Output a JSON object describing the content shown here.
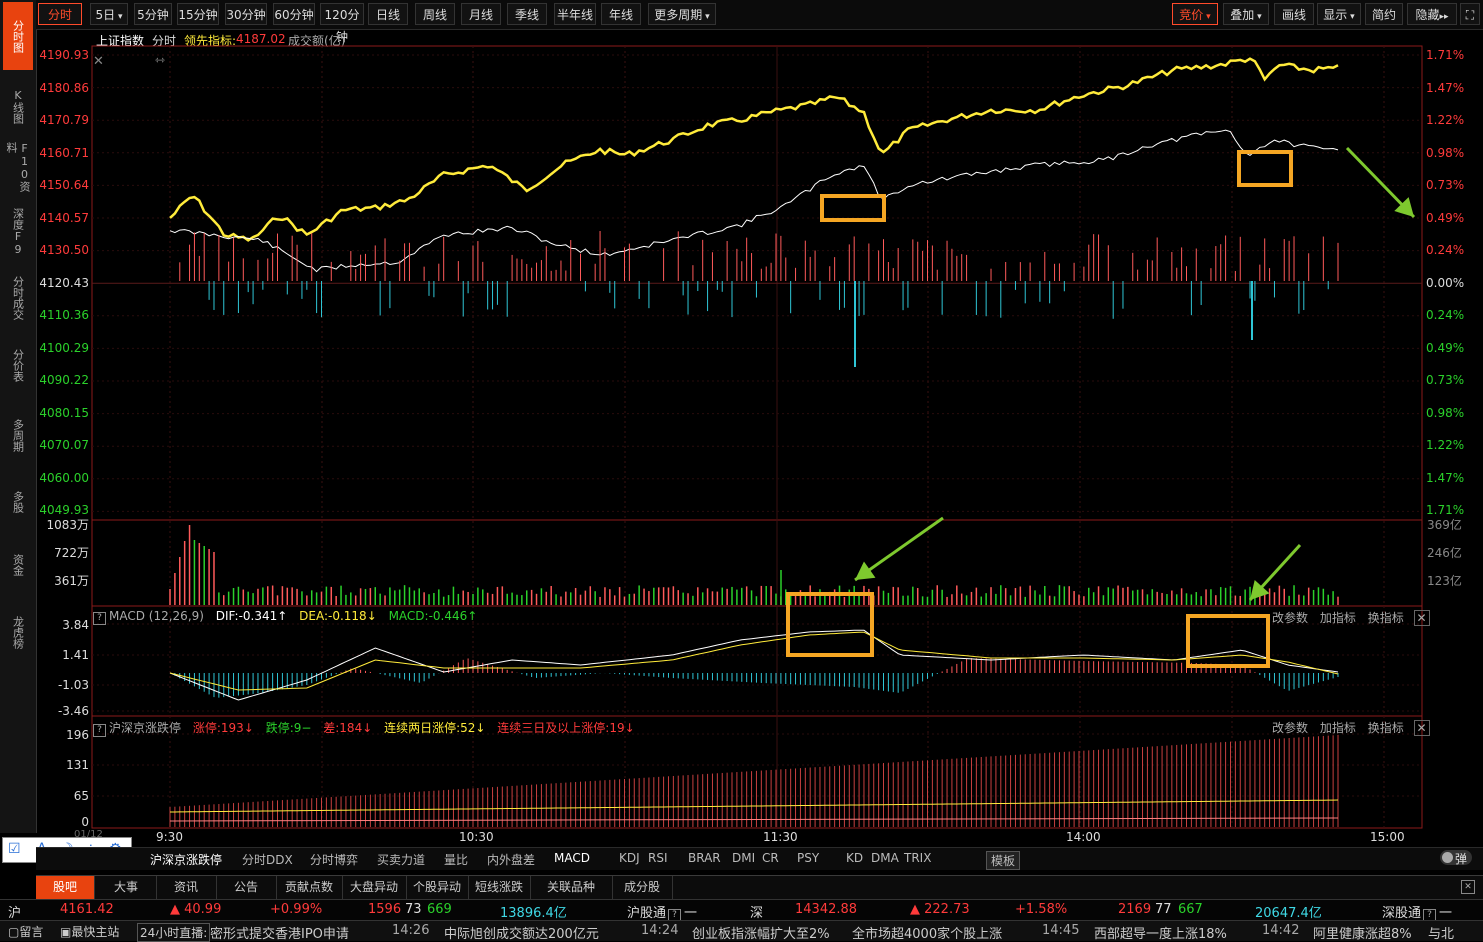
{
  "sidebar": {
    "items": [
      "分时图",
      "K线图",
      "F10资料",
      "深度F9",
      "分时成交",
      "分价表",
      "多周期",
      "多股",
      "资金",
      "龙虎榜"
    ]
  },
  "toolbar": {
    "left": [
      "分时",
      "5日",
      "5分钟",
      "15分钟",
      "30分钟",
      "60分钟",
      "120分钟",
      "日线",
      "周线",
      "月线",
      "季线",
      "半年线",
      "年线",
      "更多周期"
    ],
    "right": [
      "竞价",
      "叠加",
      "画线",
      "显示",
      "简约",
      "隐藏"
    ]
  },
  "header": {
    "name": "上证指数",
    "mode": "分时",
    "lead_label": "领先指标:",
    "lead_value": "4187.02",
    "volume_label": "成交额(亿)"
  },
  "price_axis": {
    "left": [
      "4190.93",
      "4180.86",
      "4170.79",
      "4160.71",
      "4150.64",
      "4140.57",
      "4130.50",
      "4120.43",
      "4110.36",
      "4100.29",
      "4090.22",
      "4080.15",
      "4070.07",
      "4060.00",
      "4049.93"
    ],
    "right": [
      "1.71%",
      "1.47%",
      "1.22%",
      "0.98%",
      "0.73%",
      "0.49%",
      "0.24%",
      "0.00%",
      "0.24%",
      "0.49%",
      "0.73%",
      "0.98%",
      "1.22%",
      "1.47%",
      "1.71%"
    ]
  },
  "volume_axis": {
    "left": [
      "1083万",
      "722万",
      "361万"
    ],
    "right": [
      "369亿",
      "246亿",
      "123亿"
    ]
  },
  "macd": {
    "title": "MACD (12,26,9)",
    "dif": "DIF:-0.341↑",
    "dea": "DEA:-0.118↓",
    "macd": "MACD:-0.446↑",
    "axis": [
      "3.84",
      "1.41",
      "-1.03",
      "-3.46"
    ],
    "actions": [
      "改参数",
      "加指标",
      "换指标"
    ]
  },
  "limit": {
    "title": "沪深京涨跌停",
    "up": "涨停:193↓",
    "down": "跌停:9−",
    "diff": "差:184↓",
    "two_day": "连续两日涨停:52↓",
    "three_day": "连续三日及以上涨停:19↓",
    "axis": [
      "196",
      "131",
      "65",
      "0"
    ],
    "actions": [
      "改参数",
      "加指标",
      "换指标"
    ]
  },
  "time_axis": [
    "9:30",
    "10:30",
    "11:30",
    "14:00",
    "15:00"
  ],
  "date_label": "01/12",
  "indicator_tabs": [
    "沪深京涨跌停",
    "分时DDX",
    "分时博弈",
    "买卖力道",
    "量比",
    "内外盘差",
    "MACD",
    "KDJ",
    "RSI",
    "BRAR",
    "DMI",
    "CR",
    "PSY",
    "KD",
    "DMA",
    "TRIX",
    "模板"
  ],
  "popup_label": "弹",
  "bottom_tabs": [
    "股吧",
    "大事",
    "资讯",
    "公告",
    "贡献点数",
    "大盘异动",
    "个股异动",
    "短线涨跌",
    "关联品种",
    "成分股"
  ],
  "status": {
    "sh_label": "沪",
    "sh_price": "4161.42",
    "sh_change": "▲ 40.99",
    "sh_pct": "+0.99%",
    "sh_up": "1596",
    "sh_flat": "73",
    "sh_down": "669",
    "sh_amount": "13896.4亿",
    "sh_connect": "沪股通",
    "sh_connect_val": "一",
    "sz_label": "深",
    "sz_price": "14342.88",
    "sz_change": "▲ 222.73",
    "sz_pct": "+1.58%",
    "sz_up": "2169",
    "sz_flat": "77",
    "sz_down": "667",
    "sz_amount": "20647.4亿",
    "sz_connect": "深股通",
    "sz_connect_val": "一"
  },
  "news": {
    "msg": "留言",
    "fast": "最快主站",
    "live": "24小时直播:",
    "items": [
      {
        "text": "密形式提交香港IPO申请",
        "time": "14:26"
      },
      {
        "text": "中际旭创成交额达200亿元",
        "time": "14:24"
      },
      {
        "text": "创业板指涨幅扩大至2%",
        "time": ""
      },
      {
        "text": "全市场超4000家个股上涨",
        "time": "14:45"
      },
      {
        "text": "西部超导一度上涨18%",
        "time": "14:42"
      },
      {
        "text": "阿里健康涨超8%",
        "time": ""
      },
      {
        "text": "与北",
        "time": ""
      }
    ]
  },
  "colors": {
    "accent": "#e8430f",
    "up": "#ff3b3b",
    "down": "#2bd12b",
    "price_line": "#ffeb3b",
    "avg_line": "#ffffff",
    "highlight": "#f5a623",
    "arrow": "#7ec92e"
  }
}
